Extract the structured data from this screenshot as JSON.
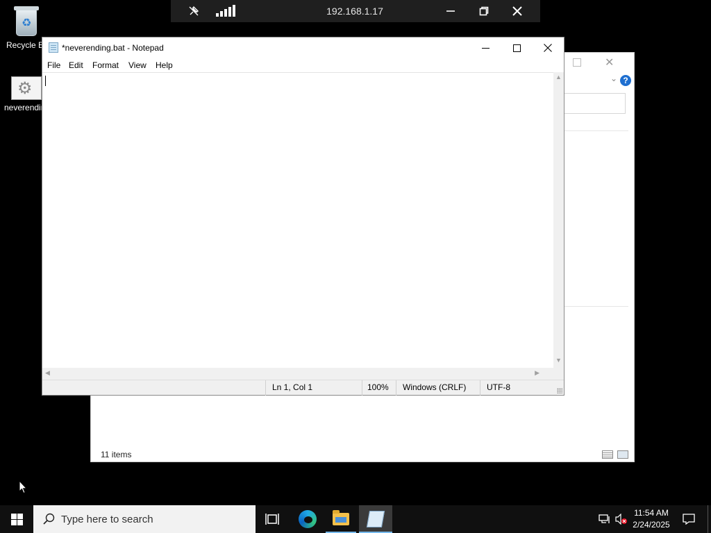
{
  "desktop": {
    "icons": [
      {
        "label": "Recycle Bin",
        "icon": "recycle-bin-icon"
      },
      {
        "label": "neverending.bat",
        "icon": "batch-file-icon"
      }
    ]
  },
  "rdp_bar": {
    "host": "192.168.1.17",
    "pin_icon": "pin-icon",
    "signal_icon": "connection-signal-icon",
    "minimize_icon": "minimize-icon",
    "restore_icon": "restore-icon",
    "close_icon": "close-icon"
  },
  "explorer_window": {
    "status_text": "11 items"
  },
  "notepad": {
    "title": "*neverending.bat - Notepad",
    "menu": [
      "File",
      "Edit",
      "Format",
      "View",
      "Help"
    ],
    "content": "",
    "status": {
      "position": "Ln 1, Col 1",
      "zoom": "100%",
      "line_ending": "Windows (CRLF)",
      "encoding": "UTF-8"
    }
  },
  "taskbar": {
    "search_placeholder": "Type here to search",
    "apps": [
      "task-view-icon",
      "edge-icon",
      "file-explorer-icon",
      "notepad-icon"
    ],
    "clock": {
      "time": "11:54 AM",
      "date": "2/24/2025"
    }
  },
  "colors": {
    "desktop": "#000000",
    "taskbar": "#101010",
    "rdp_bar": "#1f1f1f",
    "active_indicator": "#76b9ed",
    "help_accent": "#1e6fd0"
  }
}
